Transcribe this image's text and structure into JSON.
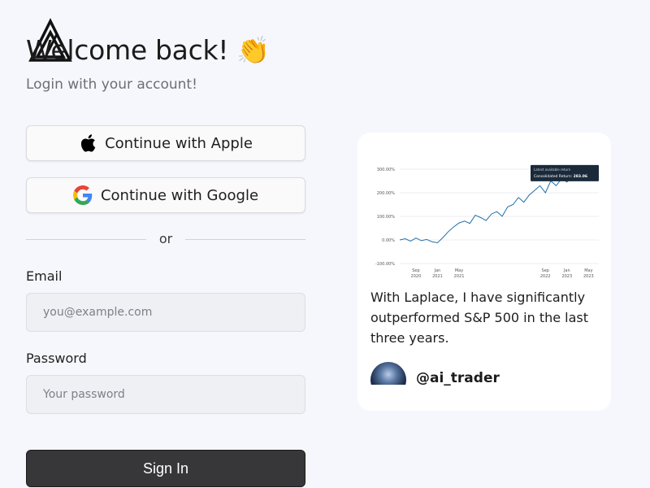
{
  "header": {
    "title": "Welcome back! 👏",
    "subtitle": "Login with your account!"
  },
  "auth": {
    "apple_label": "Continue with Apple",
    "google_label": "Continue with Google",
    "divider": "or"
  },
  "form": {
    "email_label": "Email",
    "email_placeholder": "you@example.com",
    "password_label": "Password",
    "password_placeholder": "Your password",
    "submit_label": "Sign In"
  },
  "testimonial": {
    "quote": "With Laplace, I have significantly outperformed S&P 500 in the last three years.",
    "handle": "@ai_trader"
  },
  "chart_data": {
    "type": "line",
    "x": [
      "2020-06",
      "2020-07",
      "2020-08",
      "2020-09",
      "2020-10",
      "2020-11",
      "2020-12",
      "2021-01",
      "2021-02",
      "2021-03",
      "2021-04",
      "2021-05",
      "2021-06",
      "2021-07",
      "2021-08",
      "2021-09",
      "2021-10",
      "2021-11",
      "2021-12",
      "2022-01",
      "2022-02",
      "2022-03",
      "2022-04",
      "2022-05",
      "2022-06",
      "2022-07",
      "2022-08",
      "2022-09",
      "2022-10",
      "2022-11",
      "2022-12",
      "2023-01",
      "2023-02",
      "2023-03",
      "2023-04",
      "2023-05",
      "2023-06"
    ],
    "values": [
      0,
      5,
      -5,
      8,
      -3,
      2,
      -8,
      -12,
      10,
      35,
      55,
      72,
      80,
      70,
      105,
      95,
      82,
      110,
      120,
      100,
      140,
      150,
      180,
      160,
      190,
      210,
      230,
      200,
      250,
      230,
      260,
      245,
      270,
      260,
      275,
      270,
      283.06
    ],
    "y_ticks": [
      "300.00%",
      "200.00%",
      "100.00%",
      "0.00%",
      "-100.00%"
    ],
    "y_tick_values": [
      300,
      200,
      100,
      0,
      -100
    ],
    "ylim": [
      -100,
      300
    ],
    "x_ticks": [
      {
        "at": "2020-09",
        "label": [
          "Sep",
          "2020"
        ]
      },
      {
        "at": "2021-05",
        "label": [
          "May",
          "2021"
        ]
      },
      {
        "at": "2021-01",
        "label": [
          "Jan",
          "2021"
        ]
      }
    ],
    "x_ticks_extra": [
      {
        "at": "2022-09",
        "label": [
          "Sep",
          "2022"
        ]
      },
      {
        "at": "2023-05",
        "label": [
          "May",
          "2023"
        ]
      },
      {
        "at": "2023-01",
        "label": [
          "Jan",
          "2023"
        ]
      }
    ],
    "tooltip": {
      "line1": "Latest available return",
      "line2": "Consolidated Return:",
      "value": "283.06"
    },
    "line_color": "#1f6fa8",
    "grid": true
  }
}
